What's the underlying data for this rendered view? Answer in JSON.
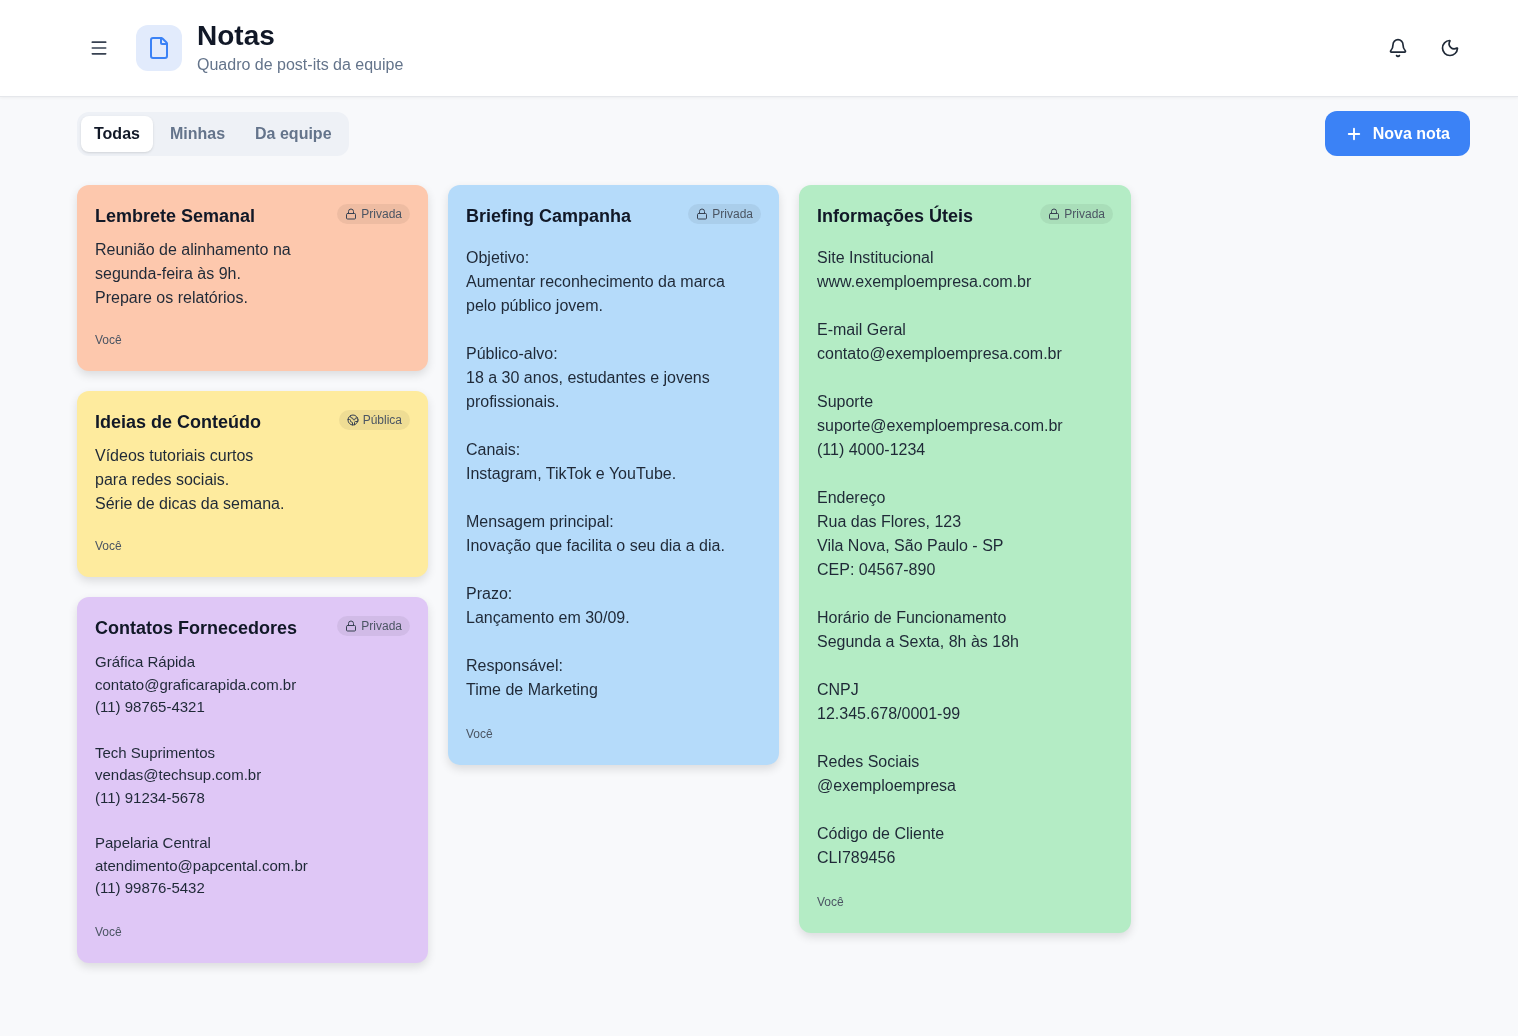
{
  "header": {
    "title": "Notas",
    "subtitle": "Quadro de post-its da equipe"
  },
  "tabs": [
    {
      "label": "Todas",
      "selected": true
    },
    {
      "label": "Minhas",
      "selected": false
    },
    {
      "label": "Da equipe",
      "selected": false
    }
  ],
  "new_note_button": {
    "label": "Nova nota"
  },
  "columns": [
    {
      "notes": [
        {
          "kind": "note",
          "title": "Lembrete Semanal",
          "color": "#fdc8ad",
          "visibility": {
            "kind": "private",
            "label": "Privada"
          },
          "body": [
            "Reunião de alinhamento na\nsegunda-feira às 9h.\nPrepare os relatórios."
          ],
          "author": "Você"
        },
        {
          "kind": "note",
          "title": "Ideias de Conteúdo",
          "color": "#feeb9e",
          "visibility": {
            "kind": "public",
            "label": "Pública"
          },
          "body": [
            "Vídeos tutoriais curtos\npara redes sociais.\nSérie de dicas da semana."
          ],
          "author": "Você"
        },
        {
          "kind": "contacts",
          "title": "Contatos Fornecedores",
          "color": "#dfc7f6",
          "visibility": {
            "kind": "private",
            "label": "Privada"
          },
          "body": [
            "Gráfica Rápida\ncontato@graficarapida.com.br\n(11) 98765-4321",
            "Tech Suprimentos\nvendas@techsup.com.br\n(11) 91234-5678",
            "Papelaria Central\natendimento@papcental.com.br\n(11) 99876-5432"
          ],
          "author": "Você"
        }
      ]
    },
    {
      "notes": [
        {
          "kind": "sections",
          "title": "Briefing Campanha",
          "color": "#b5dbfa",
          "visibility": {
            "kind": "private",
            "label": "Privada"
          },
          "body": [
            "Objetivo:\nAumentar reconhecimento da marca\npelo público jovem.",
            "Público-alvo:\n18 a 30 anos, estudantes e jovens\nprofissionais.",
            "Canais:\nInstagram, TikTok e YouTube.",
            "Mensagem principal:\nInovação que facilita o seu dia a dia.",
            "Prazo:\nLançamento em 30/09.",
            "Responsável:\nTime de Marketing"
          ],
          "author": "Você"
        }
      ]
    },
    {
      "notes": [
        {
          "kind": "sections",
          "title": "Informações Úteis",
          "color": "#b4ecc5",
          "visibility": {
            "kind": "private",
            "label": "Privada"
          },
          "body": [
            "Site Institucional\nwww.exemploempresa.com.br",
            "E-mail Geral\ncontato@exemploempresa.com.br",
            "Suporte\nsuporte@exemploempresa.com.br\n(11) 4000-1234",
            "Endereço\nRua das Flores, 123\nVila Nova, São Paulo - SP\nCEP: 04567-890",
            "Horário de Funcionamento\nSegunda a Sexta, 8h às 18h",
            "CNPJ\n12.345.678/0001-99",
            "Redes Sociais\n@exemploempresa",
            "Código de Cliente\nCLI789456"
          ],
          "author": "Você"
        }
      ]
    }
  ]
}
